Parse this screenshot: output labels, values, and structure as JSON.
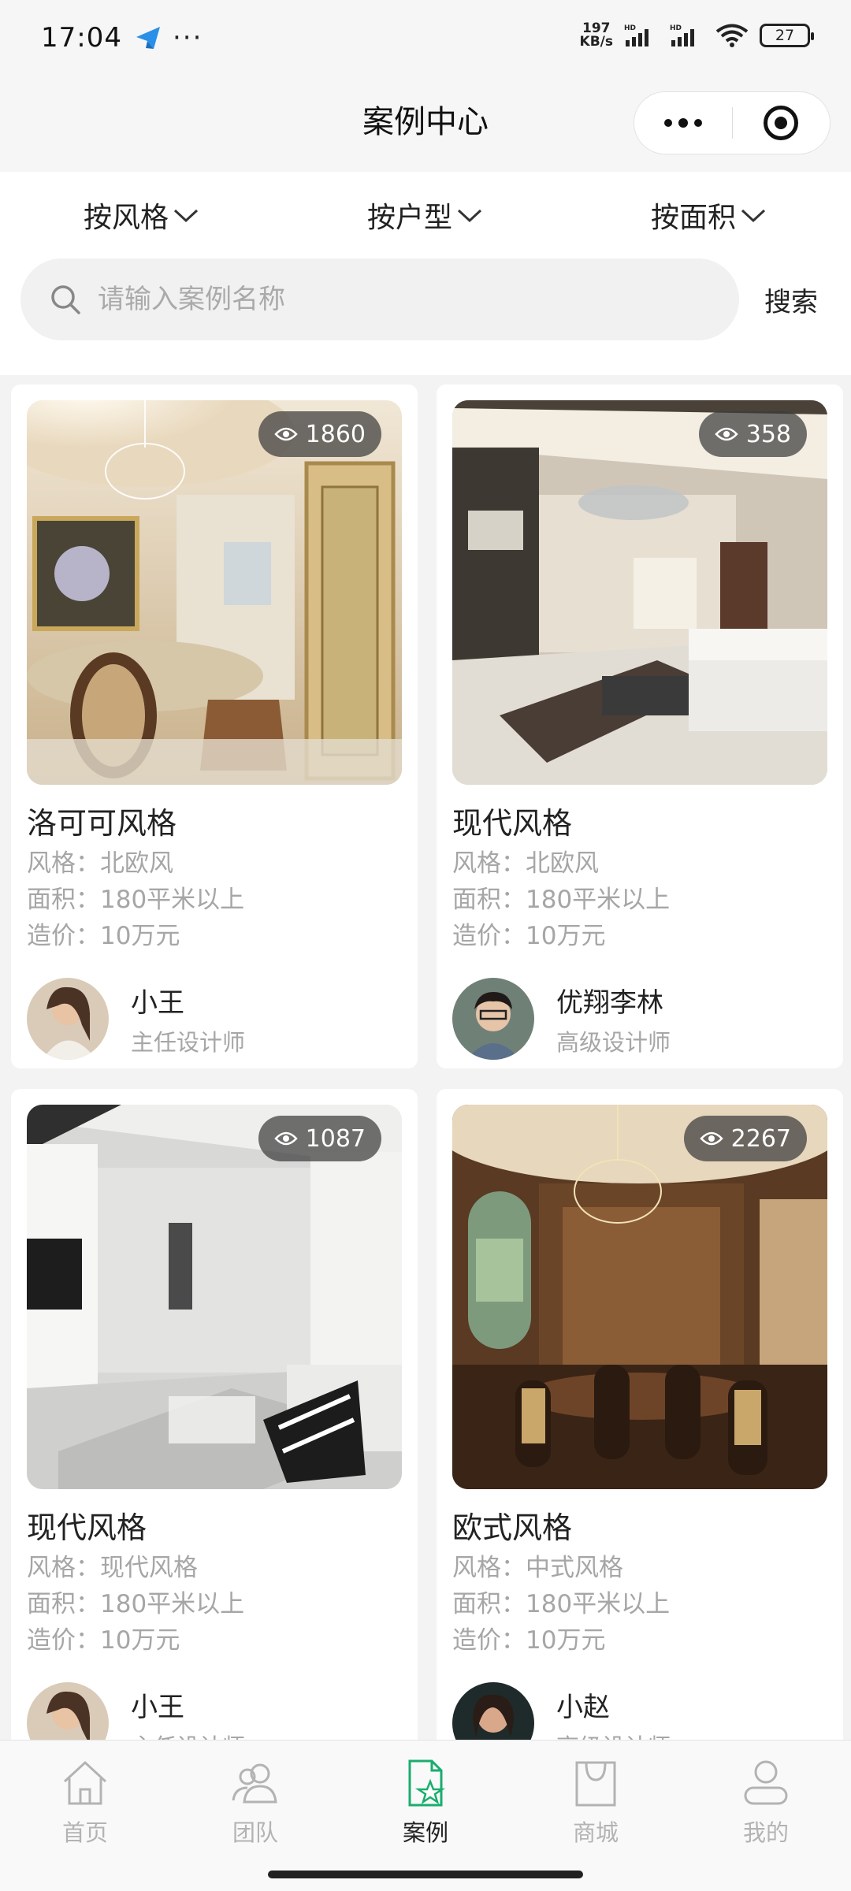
{
  "status_bar": {
    "time": "17:04",
    "dots": "···",
    "speed_value": "197",
    "speed_unit": "KB/s",
    "battery": "27"
  },
  "nav": {
    "title": "案例中心"
  },
  "filters": [
    {
      "label": "按风格"
    },
    {
      "label": "按户型"
    },
    {
      "label": "按面积"
    }
  ],
  "search": {
    "placeholder": "请输入案例名称",
    "button": "搜索"
  },
  "cases": [
    {
      "title": "洛可可风格",
      "views": "1860",
      "style": "风格：北欧风",
      "area": "面积：180平米以上",
      "cost": "造价：10万元",
      "designer_name": "小王",
      "designer_title": "主任设计师",
      "image": "rococo-dining-room"
    },
    {
      "title": "现代风格",
      "views": "358",
      "style": "风格：北欧风",
      "area": "面积：180平米以上",
      "cost": "造价：10万元",
      "designer_name": "优翔李林",
      "designer_title": "高级设计师",
      "image": "modern-living-room"
    },
    {
      "title": "现代风格",
      "views": "1087",
      "style": "风格：现代风格",
      "area": "面积：180平米以上",
      "cost": "造价：10万元",
      "designer_name": "小王",
      "designer_title": "主任设计师",
      "image": "minimal-white-living-room"
    },
    {
      "title": "欧式风格",
      "views": "2267",
      "style": "风格：中式风格",
      "area": "面积：180平米以上",
      "cost": "造价：10万元",
      "designer_name": "小赵",
      "designer_title": "高级设计师",
      "image": "european-dining-room"
    }
  ],
  "tabs": [
    {
      "label": "首页",
      "icon": "home-icon",
      "active": false
    },
    {
      "label": "团队",
      "icon": "team-icon",
      "active": false
    },
    {
      "label": "案例",
      "icon": "case-icon",
      "active": true
    },
    {
      "label": "商城",
      "icon": "shop-icon",
      "active": false
    },
    {
      "label": "我的",
      "icon": "profile-icon",
      "active": false
    }
  ],
  "colors": {
    "accent": "#1aad6e",
    "inactive": "#b3b3b3",
    "muted_text": "#a6a6a6"
  }
}
